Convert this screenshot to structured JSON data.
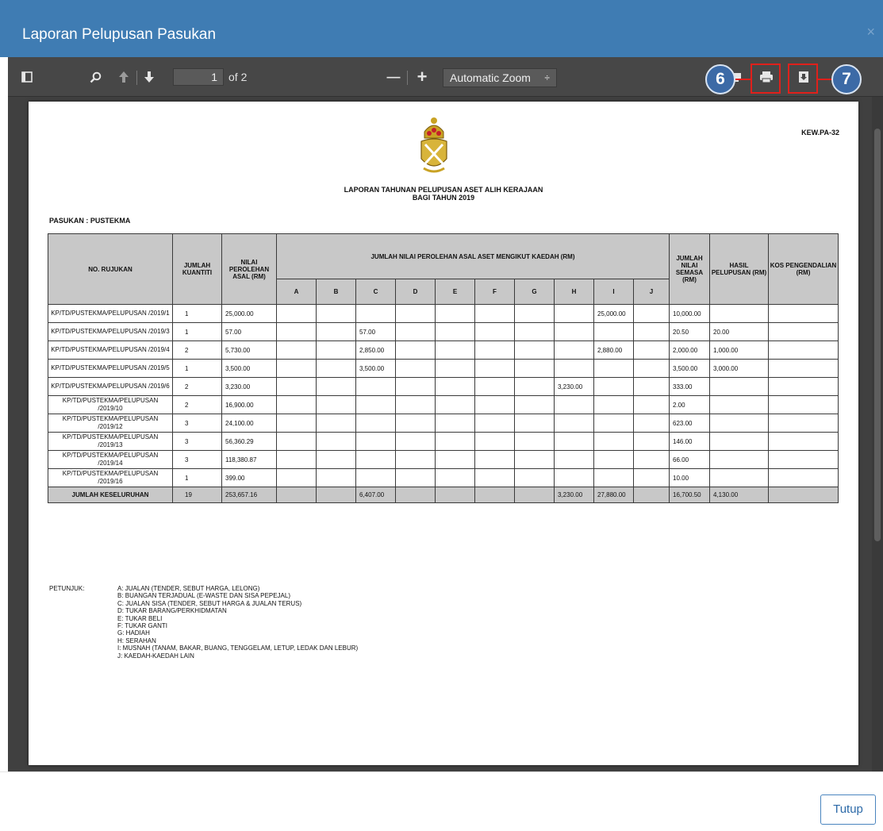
{
  "modal": {
    "title": "Laporan Pelupusan Pasukan",
    "close_glyph": "×",
    "footer_button": "Tutup"
  },
  "toolbar": {
    "page_number": "1",
    "page_count_label": "of 2",
    "zoom_label": "Automatic Zoom",
    "zoom_arrow": "÷",
    "zoom_out": "—",
    "zoom_in": "+",
    "icons": [
      "sidebar-toggle-icon",
      "search-icon",
      "previous-page-icon",
      "next-page-icon",
      "presentation-mode-icon",
      "print-icon",
      "download-icon",
      "bookmark-icon"
    ]
  },
  "callouts": [
    "6",
    "7"
  ],
  "document": {
    "form_code": "KEW.PA-32",
    "title_line1": "LAPORAN TAHUNAN PELUPUSAN ASET ALIH KERAJAAN",
    "title_line2": "BAGI TAHUN 2019",
    "pasukan": "PASUKAN : PUSTEKMA",
    "headers": {
      "no_rujukan": "NO. RUJUKAN",
      "jumlah_kuantiti": "JUMLAH KUANTITI",
      "nilai_perolehan": "NILAI PEROLEHAN ASAL (RM)",
      "jumlah_nilai_kaedah": "JUMLAH NILAI PEROLEHAN ASAL ASET MENGIKUT KAEDAH (RM)",
      "methods": [
        "A",
        "B",
        "C",
        "D",
        "E",
        "F",
        "G",
        "H",
        "I",
        "J"
      ],
      "jumlah_semasa": "JUMLAH NILAI SEMASA (RM)",
      "hasil_pelupusan": "HASIL PELUPUSAN (RM)",
      "kos_pengendalian": "KOS PENGENDALIAN (RM)"
    },
    "rows": [
      {
        "ref": "KP/TD/PUSTEKMA/PELUPUSAN /2019/1",
        "qty": "1",
        "nilai": "25,000.00",
        "m": [
          "",
          "",
          "",
          "",
          "",
          "",
          "",
          "",
          "25,000.00",
          ""
        ],
        "semasa": "10,000.00",
        "hasil": "",
        "kos": ""
      },
      {
        "ref": "KP/TD/PUSTEKMA/PELUPUSAN /2019/3",
        "qty": "1",
        "nilai": "57.00",
        "m": [
          "",
          "",
          "57.00",
          "",
          "",
          "",
          "",
          "",
          "",
          ""
        ],
        "semasa": "20.50",
        "hasil": "20.00",
        "kos": ""
      },
      {
        "ref": "KP/TD/PUSTEKMA/PELUPUSAN /2019/4",
        "qty": "2",
        "nilai": "5,730.00",
        "m": [
          "",
          "",
          "2,850.00",
          "",
          "",
          "",
          "",
          "",
          "2,880.00",
          ""
        ],
        "semasa": "2,000.00",
        "hasil": "1,000.00",
        "kos": ""
      },
      {
        "ref": "KP/TD/PUSTEKMA/PELUPUSAN /2019/5",
        "qty": "1",
        "nilai": "3,500.00",
        "m": [
          "",
          "",
          "3,500.00",
          "",
          "",
          "",
          "",
          "",
          "",
          ""
        ],
        "semasa": "3,500.00",
        "hasil": "3,000.00",
        "kos": ""
      },
      {
        "ref": "KP/TD/PUSTEKMA/PELUPUSAN /2019/6",
        "qty": "2",
        "nilai": "3,230.00",
        "m": [
          "",
          "",
          "",
          "",
          "",
          "",
          "",
          "3,230.00",
          "",
          ""
        ],
        "semasa": "333.00",
        "hasil": "",
        "kos": ""
      },
      {
        "ref": "KP/TD/PUSTEKMA/PELUPUSAN /2019/10",
        "qty": "2",
        "nilai": "16,900.00",
        "m": [
          "",
          "",
          "",
          "",
          "",
          "",
          "",
          "",
          "",
          ""
        ],
        "semasa": "2.00",
        "hasil": "",
        "kos": ""
      },
      {
        "ref": "KP/TD/PUSTEKMA/PELUPUSAN /2019/12",
        "qty": "3",
        "nilai": "24,100.00",
        "m": [
          "",
          "",
          "",
          "",
          "",
          "",
          "",
          "",
          "",
          ""
        ],
        "semasa": "623.00",
        "hasil": "",
        "kos": ""
      },
      {
        "ref": "KP/TD/PUSTEKMA/PELUPUSAN /2019/13",
        "qty": "3",
        "nilai": "56,360.29",
        "m": [
          "",
          "",
          "",
          "",
          "",
          "",
          "",
          "",
          "",
          ""
        ],
        "semasa": "146.00",
        "hasil": "",
        "kos": ""
      },
      {
        "ref": "KP/TD/PUSTEKMA/PELUPUSAN /2019/14",
        "qty": "3",
        "nilai": "118,380.87",
        "m": [
          "",
          "",
          "",
          "",
          "",
          "",
          "",
          "",
          "",
          ""
        ],
        "semasa": "66.00",
        "hasil": "",
        "kos": ""
      },
      {
        "ref": "KP/TD/PUSTEKMA/PELUPUSAN /2019/16",
        "qty": "1",
        "nilai": "399.00",
        "m": [
          "",
          "",
          "",
          "",
          "",
          "",
          "",
          "",
          "",
          ""
        ],
        "semasa": "10.00",
        "hasil": "",
        "kos": ""
      }
    ],
    "total": {
      "ref": "JUMLAH KESELURUHAN",
      "qty": "19",
      "nilai": "253,657.16",
      "m": [
        "",
        "",
        "6,407.00",
        "",
        "",
        "",
        "",
        "3,230.00",
        "27,880.00",
        ""
      ],
      "semasa": "16,700.50",
      "hasil": "4,130.00",
      "kos": ""
    },
    "petunjuk_label": "PETUNJUK:",
    "petunjuk": [
      "A: JUALAN (TENDER, SEBUT HARGA, LELONG)",
      "B: BUANGAN TERJADUAL (E-WASTE DAN SISA PEPEJAL)",
      "C: JUALAN SISA (TENDER, SEBUT HARGA & JUALAN TERUS)",
      "D: TUKAR BARANG/PERKHIDMATAN",
      "E: TUKAR BELI",
      "F: TUKAR GANTI",
      "G: HADIAH",
      "H: SERAHAN",
      "I: MUSNAH (TANAM, BAKAR, BUANG, TENGGELAM, LETUP, LEDAK DAN LEBUR)",
      "J: KAEDAH-KAEDAH LAIN"
    ]
  },
  "colors": {
    "header_blue": "#3f7cb3",
    "toolbar_dark": "#474747",
    "highlight_red": "#e0201b",
    "callout_blue": "#3c6aa6",
    "table_header_grey": "#c8c8c8"
  }
}
